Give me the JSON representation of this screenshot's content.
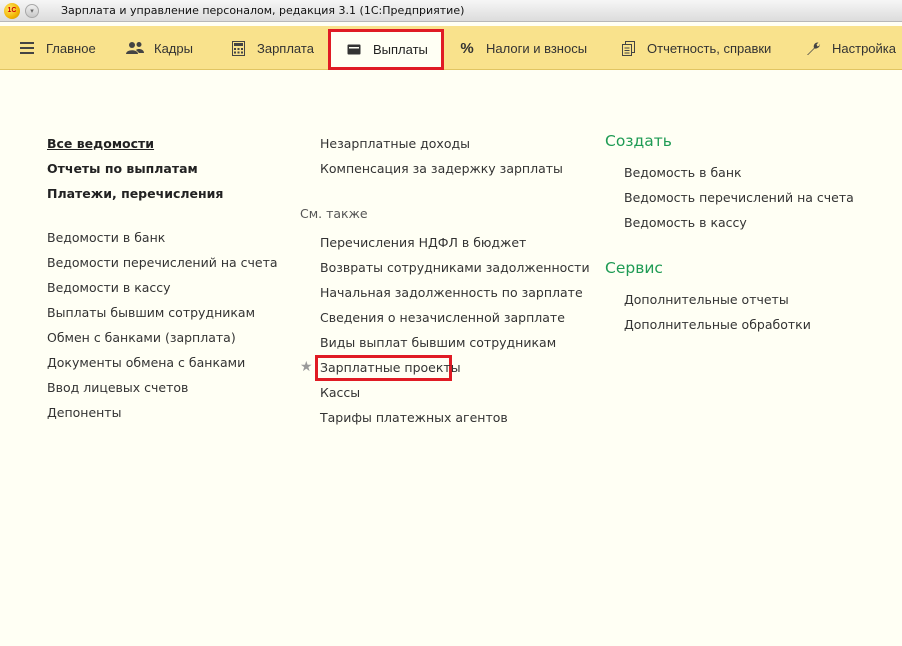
{
  "window": {
    "title": "Зарплата и управление персоналом, редакция 3.1  (1С:Предприятие)",
    "logo_text": "1С"
  },
  "menubar": {
    "items": [
      {
        "label": "Главное",
        "icon": "hamburger-icon"
      },
      {
        "label": "Кадры",
        "icon": "people-icon"
      },
      {
        "label": "Зарплата",
        "icon": "calculator-icon"
      },
      {
        "label": "Выплаты",
        "icon": "wallet-icon"
      },
      {
        "label": "Налоги и взносы",
        "icon": "percent-icon"
      },
      {
        "label": "Отчетность, справки",
        "icon": "documents-icon"
      },
      {
        "label": "Настройка",
        "icon": "wrench-icon"
      }
    ],
    "active_index": 3
  },
  "left_column": {
    "bold_links": [
      "Все ведомости",
      "Отчеты по выплатам",
      "Платежи, перечисления"
    ],
    "links": [
      "Ведомости в банк",
      "Ведомости перечислений на счета",
      "Ведомости в кассу",
      "Выплаты бывшим сотрудникам",
      "Обмен с банками (зарплата)",
      "Документы обмена с банками",
      "Ввод лицевых счетов",
      "Депоненты"
    ]
  },
  "middle_column": {
    "links_top": [
      "Незарплатные доходы",
      "Компенсация за задержку зарплаты"
    ],
    "see_also_label": "См. также",
    "see_also_links": [
      "Перечисления НДФЛ в бюджет",
      "Возвраты сотрудниками задолженности",
      "Начальная задолженность по зарплате",
      "Сведения о незачисленной зарплате",
      "Виды выплат бывшим сотрудникам",
      "Зарплатные проекты",
      "Кассы",
      "Тарифы платежных агентов"
    ],
    "starred_item": "Зарплатные проекты"
  },
  "right_column": {
    "create_title": "Создать",
    "create_links": [
      "Ведомость в банк",
      "Ведомость перечислений на счета",
      "Ведомость в кассу"
    ],
    "service_title": "Сервис",
    "service_links": [
      "Дополнительные отчеты",
      "Дополнительные обработки"
    ]
  },
  "colors": {
    "menubar_bg": "#f9e28c",
    "content_bg": "#fffff4",
    "section_green": "#1e9b54",
    "highlight_red": "#e01b24"
  }
}
